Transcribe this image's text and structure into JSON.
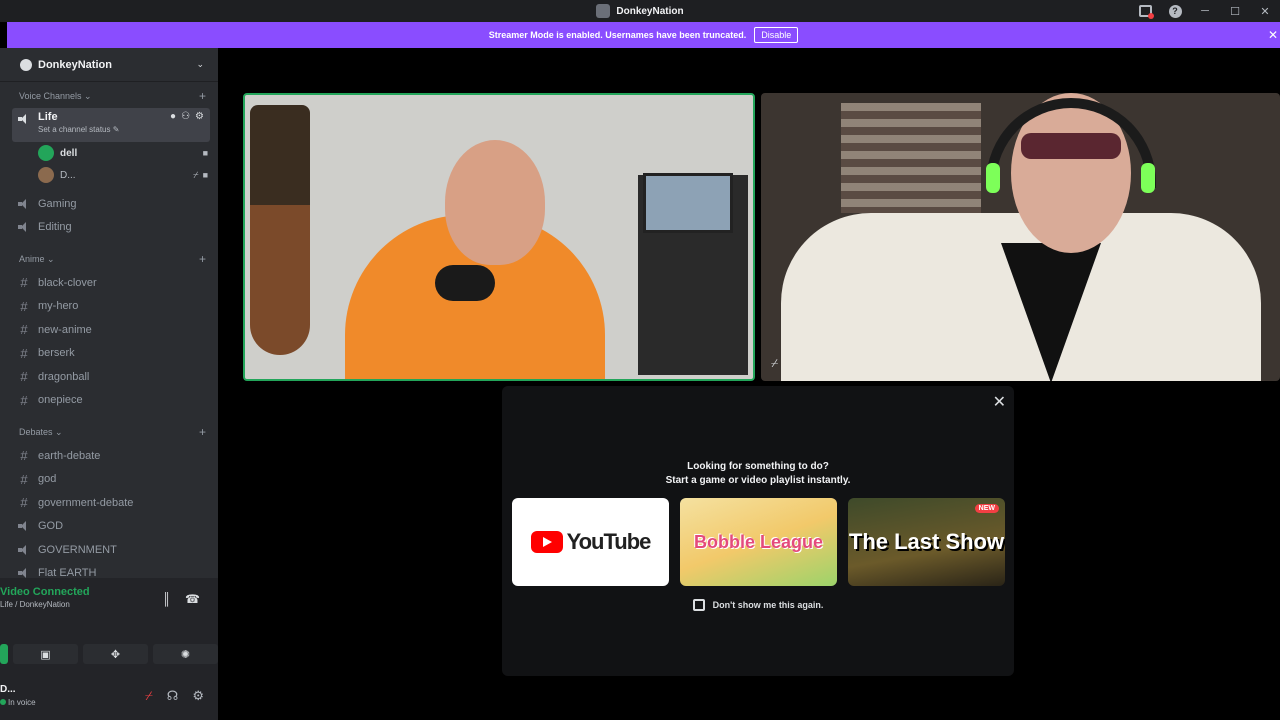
{
  "window": {
    "title": "DonkeyNation"
  },
  "banner": {
    "text": "Streamer Mode is enabled. Usernames have been truncated.",
    "disable_label": "Disable"
  },
  "sidebar": {
    "guild_name": "DonkeyNation",
    "voice_category": "Voice Channels",
    "active_channel": {
      "name": "Life",
      "status": "Set a channel status"
    },
    "members": [
      {
        "name": "dell"
      },
      {
        "name": "D..."
      }
    ],
    "voice_channels": [
      {
        "name": "Gaming"
      },
      {
        "name": "Editing"
      }
    ],
    "anime_category": "Anime",
    "anime_channels": [
      {
        "name": "black-clover"
      },
      {
        "name": "my-hero"
      },
      {
        "name": "new-anime"
      },
      {
        "name": "berserk"
      },
      {
        "name": "dragonball"
      },
      {
        "name": "onepiece"
      }
    ],
    "debates_category": "Debates",
    "debate_channels": [
      {
        "name": "earth-debate",
        "type": "text"
      },
      {
        "name": "god",
        "type": "text"
      },
      {
        "name": "government-debate",
        "type": "text"
      },
      {
        "name": "GOD",
        "type": "voice"
      },
      {
        "name": "GOVERNMENT",
        "type": "voice"
      },
      {
        "name": "Flat EARTH",
        "type": "voice"
      }
    ]
  },
  "voice_panel": {
    "title": "Video Connected",
    "subtitle": "Life / DonkeyNation"
  },
  "user": {
    "name": "D...",
    "status": "In voice"
  },
  "modal": {
    "heading_line1": "Looking for something to do?",
    "heading_line2": "Start a game or video playlist instantly.",
    "cards": [
      {
        "name": "YouTube"
      },
      {
        "name": "Bobble League"
      },
      {
        "name": "The Last Show",
        "badge": "NEW"
      }
    ],
    "dont_show_label": "Don't show me this again."
  },
  "colors": {
    "accent": "#8a4dff",
    "connected": "#23a55a",
    "danger": "#f23f43"
  }
}
